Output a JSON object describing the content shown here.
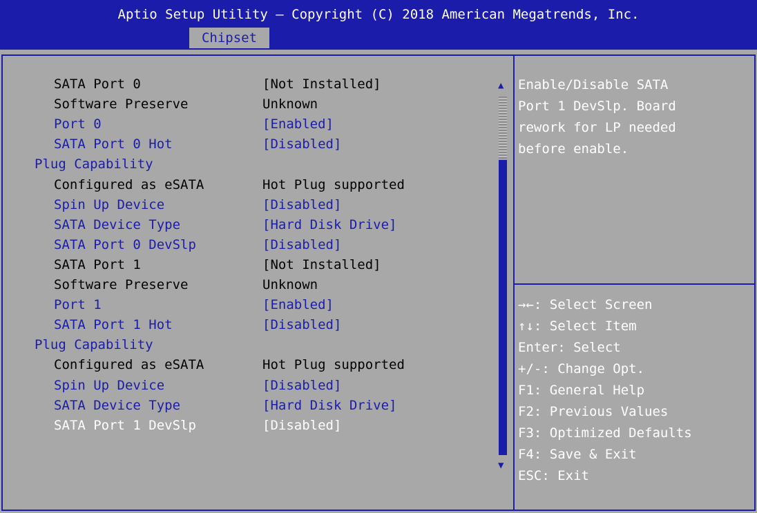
{
  "header": {
    "title": "Aptio Setup Utility – Copyright (C) 2018 American Megatrends, Inc.",
    "active_tab": "Chipset"
  },
  "settings": [
    {
      "label": "SATA Port 0",
      "value": "[Not Installed]",
      "kind": "static"
    },
    {
      "label": "Software Preserve",
      "value": "Unknown",
      "kind": "static"
    },
    {
      "label": "Port 0",
      "value": "[Enabled]",
      "kind": "option"
    },
    {
      "label": "SATA Port 0 Hot",
      "value": "[Disabled]",
      "kind": "option"
    },
    {
      "label": "Plug Capability",
      "value": "",
      "kind": "continuation"
    },
    {
      "label": "Configured as eSATA",
      "value": "Hot Plug supported",
      "kind": "static"
    },
    {
      "label": "Spin Up Device",
      "value": "[Disabled]",
      "kind": "option"
    },
    {
      "label": "SATA Device Type",
      "value": "[Hard Disk Drive]",
      "kind": "option"
    },
    {
      "label": "SATA Port 0 DevSlp",
      "value": "[Disabled]",
      "kind": "option"
    },
    {
      "label": "SATA Port 1",
      "value": "[Not Installed]",
      "kind": "static"
    },
    {
      "label": "Software Preserve",
      "value": "Unknown",
      "kind": "static"
    },
    {
      "label": "Port 1",
      "value": "[Enabled]",
      "kind": "option"
    },
    {
      "label": "SATA Port 1 Hot",
      "value": "[Disabled]",
      "kind": "option"
    },
    {
      "label": "Plug Capability",
      "value": "",
      "kind": "continuation"
    },
    {
      "label": "Configured as eSATA",
      "value": "Hot Plug supported",
      "kind": "static"
    },
    {
      "label": "Spin Up Device",
      "value": "[Disabled]",
      "kind": "option"
    },
    {
      "label": "SATA Device Type",
      "value": "[Hard Disk Drive]",
      "kind": "option"
    },
    {
      "label": "SATA Port 1 DevSlp",
      "value": "[Disabled]",
      "kind": "selected"
    }
  ],
  "scrollbar": {
    "up_arrow": "▲",
    "down_arrow": "▼"
  },
  "help": {
    "text": "Enable/Disable SATA\nPort 1 DevSlp. Board\nrework for LP needed\nbefore enable."
  },
  "keys": [
    "→←: Select Screen",
    "↑↓: Select Item",
    "Enter: Select",
    "+/-: Change Opt.",
    "F1: General Help",
    "F2: Previous Values",
    "F3: Optimized Defaults",
    "F4: Save & Exit",
    "ESC: Exit"
  ],
  "colors": {
    "background": "#a8a8a8",
    "accent": "#1c1caa",
    "highlight": "#ffffff"
  }
}
